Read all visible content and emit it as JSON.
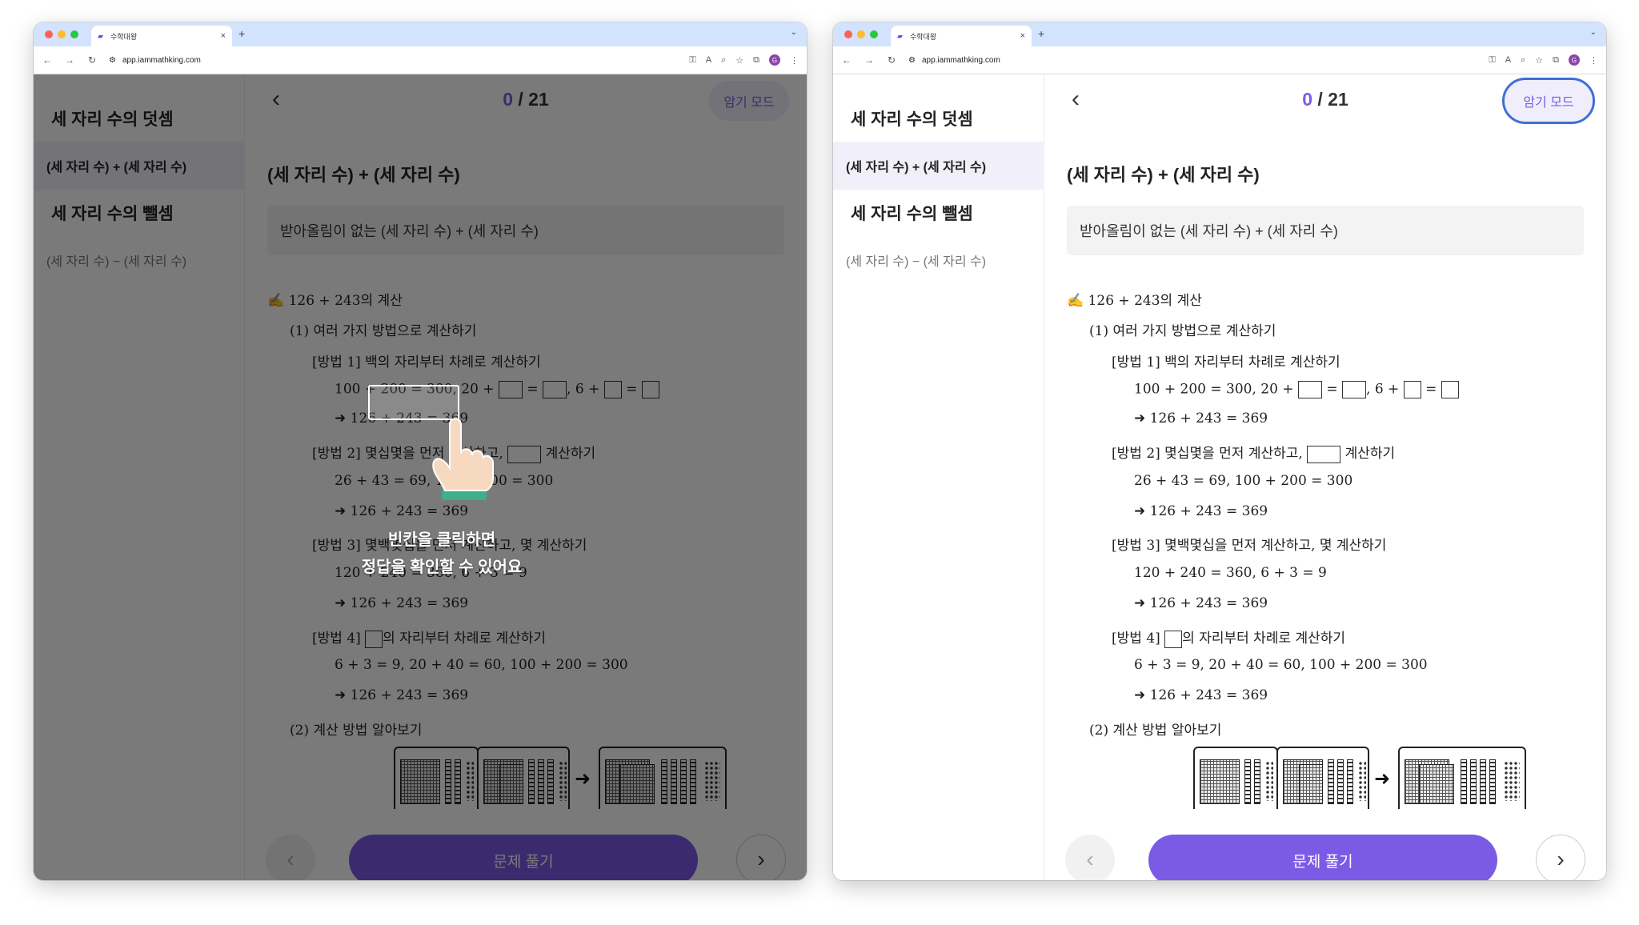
{
  "browser": {
    "tab_title": "수학대왕",
    "tab_close": "×",
    "new_tab": "+",
    "tab_menu": "⌄",
    "url": "app.iammathking.com",
    "back": "←",
    "forward": "→",
    "reload": "↻",
    "site_info": "⚙",
    "key_icon": "⚿",
    "translate_icon": "A",
    "zoom_icon": "⌕",
    "star_icon": "☆",
    "extension_icon": "⧉",
    "profile": "G",
    "menu_icon": "⋮"
  },
  "sidebar": {
    "sections": [
      {
        "title": "세 자리 수의 덧셈",
        "item": "(세 자리 수) + (세 자리 수)"
      },
      {
        "title": "세 자리 수의 뺄셈",
        "item": "(세 자리 수) − (세 자리 수)"
      }
    ]
  },
  "header": {
    "back_icon": "‹",
    "counter_current": "0",
    "counter_sep_total": " / 21",
    "memo_mode": "암기 모드"
  },
  "question": {
    "title": "(세 자리 수) + (세 자리 수)",
    "subtitle": "받아올림이 없는 (세 자리 수) + (세 자리 수)",
    "lines": {
      "l1": "✍ 126 + 243의 계산",
      "l2": "(1) 여러 가지 방법으로 계산하기",
      "l3": "[방법 1] 백의 자리부터 차례로 계산하기",
      "l4a": "100 + 200 = 300, 20 + ",
      "l4b": " = ",
      "l4c": ", 6 + ",
      "l4d": " = ",
      "l5": "126 + 243 = 369",
      "l6a": "[방법 2] 몇십몇을 먼저 계산하고, ",
      "l6b": " 계산하기",
      "l7": "26 + 43 = 69, 100 + 200 = 300",
      "l8": "126 + 243 = 369",
      "l9": "[방법 3] 몇백몇십을 먼저 계산하고, 몇 계산하기",
      "l10": "120 + 240 = 360, 6 + 3 = 9",
      "l11": "126 + 243 = 369",
      "l12a": "[방법 4] ",
      "l12b": "의 자리부터 차례로 계산하기",
      "l13": "6 + 3 = 9, 20 + 40 = 60, 100 + 200 = 300",
      "l14": "126 + 243 = 369",
      "l15": "(2) 계산 방법 알아보기",
      "arrow": "➜",
      "block_arrow": "➜"
    }
  },
  "footer": {
    "prev_icon": "‹",
    "solve_button": "문제 풀기",
    "next_icon": "›"
  },
  "overlay_hint": {
    "line1": "빈칸을 클릭하면",
    "line2": "정답을 확인할 수 있어요"
  }
}
